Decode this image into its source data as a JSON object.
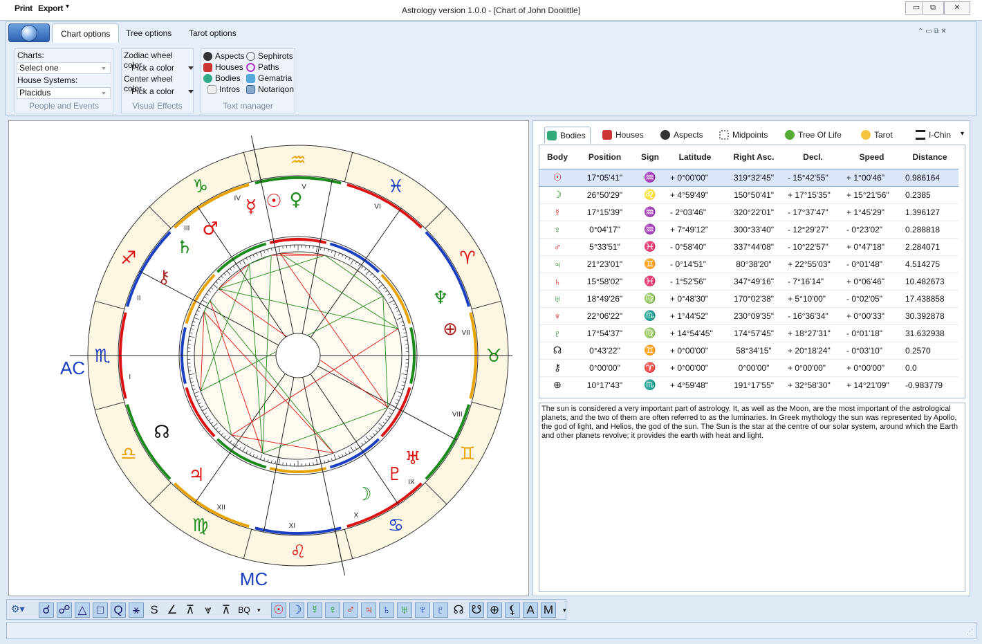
{
  "menu": {
    "print": "Print",
    "export": "Export"
  },
  "window": {
    "title": "Astrology version 1.0.0 - [Chart of John Doolittle]",
    "min": "▭",
    "max": "⧉",
    "close": "✕"
  },
  "ribbon": {
    "tabs": [
      "Chart options",
      "Tree options",
      "Tarot options"
    ],
    "people": {
      "charts_label": "Charts:",
      "charts_value": "Select one",
      "house_label": "House Systems:",
      "house_value": "Placidus",
      "group": "People and Events"
    },
    "visual": {
      "zodiac_label": "Zodiac wheel color",
      "pick1": "Pick a color",
      "center_label": "Center wheel color",
      "pick2": "Pick a color",
      "group": "Visual Effects"
    },
    "text": {
      "aspects": "Aspects",
      "houses": "Houses",
      "bodies": "Bodies",
      "intros": "Intros",
      "sephirots": "Sephirots",
      "paths": "Paths",
      "gematria": "Gematria",
      "notariqon": "Notariqon",
      "group": "Text manager"
    }
  },
  "chart": {
    "signs": [
      "♒",
      "♑",
      "♐",
      "♏",
      "♎",
      "♍",
      "♌",
      "♋",
      "♊",
      "♉",
      "♈",
      "♓"
    ],
    "houses": [
      "I",
      "II",
      "III",
      "IV",
      "V",
      "VI",
      "VII",
      "VIII",
      "IX",
      "X",
      "XI",
      "XII"
    ],
    "ac": "AC",
    "mc": "MC",
    "planets": [
      {
        "g": "♀",
        "c": "#1a8a1a"
      },
      {
        "g": "☉",
        "c": "#d11"
      },
      {
        "g": "☿",
        "c": "#d11"
      },
      {
        "g": "♂",
        "c": "#d11"
      },
      {
        "g": "♄",
        "c": "#1a8a1a"
      },
      {
        "g": "⚷",
        "c": "#a33"
      },
      {
        "g": "♆",
        "c": "#1a8a1a"
      },
      {
        "g": "⊕",
        "c": "#a22"
      },
      {
        "g": "♅",
        "c": "#d11"
      },
      {
        "g": "♇",
        "c": "#d11"
      },
      {
        "g": "☽",
        "c": "#1a8a1a"
      },
      {
        "g": "♃",
        "c": "#d11"
      },
      {
        "g": "☊",
        "c": "#111"
      }
    ]
  },
  "tabs": [
    "Bodies",
    "Houses",
    "Aspects",
    "Midpoints",
    "Tree Of Life",
    "Tarot",
    "I-Chin"
  ],
  "table": {
    "headers": [
      "Body",
      "Position",
      "Sign",
      "Latitude",
      "Right Asc.",
      "Decl.",
      "Speed",
      "Distance"
    ],
    "rows": [
      {
        "b": "☉",
        "bc": "#d11",
        "pos": "17°05'41\"",
        "sign": "♒",
        "signc": "#e8a200",
        "lat": "+  0°00'00\"",
        "ra": "319°32'45\"",
        "dec": "-  15°42'55\"",
        "spd": "+  1°00'46\"",
        "dist": "0.986164"
      },
      {
        "b": "☽",
        "bc": "#1a8a1a",
        "pos": "26°50'29\"",
        "sign": "♌",
        "signc": "#d11",
        "lat": "+  4°59'49\"",
        "ra": "150°50'41\"",
        "dec": "+ 17°15'35\"",
        "spd": "+ 15°21'56\"",
        "dist": "0.2385"
      },
      {
        "b": "☿",
        "bc": "#d11",
        "pos": "17°15'39\"",
        "sign": "♒",
        "signc": "#e8a200",
        "lat": "-  2°03'46\"",
        "ra": "320°22'01\"",
        "dec": "-  17°37'47\"",
        "spd": "+  1°45'29\"",
        "dist": "1.396127"
      },
      {
        "b": "♀",
        "bc": "#1a8a1a",
        "pos": "0°04'17\"",
        "sign": "♒",
        "signc": "#e8a200",
        "lat": "+  7°49'12\"",
        "ra": "300°33'40\"",
        "dec": "-  12°29'27\"",
        "spd": "-  0°23'02\"",
        "dist": "0.288818"
      },
      {
        "b": "♂",
        "bc": "#d11",
        "pos": "5°33'51\"",
        "sign": "♓",
        "signc": "#1a3fc0",
        "lat": "-  0°58'40\"",
        "ra": "337°44'08\"",
        "dec": "-  10°22'57\"",
        "spd": "+  0°47'18\"",
        "dist": "2.284071"
      },
      {
        "b": "♃",
        "bc": "#1a8a1a",
        "pos": "21°23'01\"",
        "sign": "♊",
        "signc": "#e8a200",
        "lat": "-  0°14'51\"",
        "ra": "80°38'20\"",
        "dec": "+ 22°55'03\"",
        "spd": "-  0°01'48\"",
        "dist": "4.514275"
      },
      {
        "b": "♄",
        "bc": "#d11",
        "pos": "15°58'02\"",
        "sign": "♓",
        "signc": "#1a3fc0",
        "lat": "-  1°52'56\"",
        "ra": "347°49'16\"",
        "dec": "-  7°16'14\"",
        "spd": "+  0°06'46\"",
        "dist": "10.482673"
      },
      {
        "b": "♅",
        "bc": "#1a8a1a",
        "pos": "18°49'26\"",
        "sign": "♍",
        "signc": "#1a8a1a",
        "lat": "+  0°48'30\"",
        "ra": "170°02'38\"",
        "dec": "+  5°10'00\"",
        "spd": "-  0°02'05\"",
        "dist": "17.438858"
      },
      {
        "b": "♆",
        "bc": "#d11",
        "pos": "22°06'22\"",
        "sign": "♏",
        "signc": "#1a3fc0",
        "lat": "+  1°44'52\"",
        "ra": "230°09'35\"",
        "dec": "-  16°36'34\"",
        "spd": "+  0°00'33\"",
        "dist": "30.392878"
      },
      {
        "b": "♇",
        "bc": "#1a8a1a",
        "pos": "17°54'37\"",
        "sign": "♍",
        "signc": "#1a8a1a",
        "lat": "+ 14°54'45\"",
        "ra": "174°57'45\"",
        "dec": "+ 18°27'31\"",
        "spd": "-  0°01'18\"",
        "dist": "31.632938"
      },
      {
        "b": "☊",
        "bc": "#111",
        "pos": "0°43'22\"",
        "sign": "♊",
        "signc": "#e8a200",
        "lat": "+  0°00'00\"",
        "ra": "58°34'15\"",
        "dec": "+ 20°18'24\"",
        "spd": "-  0°03'10\"",
        "dist": "0.2570"
      },
      {
        "b": "⚷",
        "bc": "#111",
        "pos": "0°00'00\"",
        "sign": "♈",
        "signc": "#d11",
        "lat": "+  0°00'00\"",
        "ra": "0°00'00\"",
        "dec": "+  0°00'00\"",
        "spd": "+  0°00'00\"",
        "dist": "0.0"
      },
      {
        "b": "⊕",
        "bc": "#111",
        "pos": "10°17'43\"",
        "sign": "♏",
        "signc": "#1a3fc0",
        "lat": "+  4°59'48\"",
        "ra": "191°17'55\"",
        "dec": "+ 32°58'30\"",
        "spd": "+ 14°21'09\"",
        "dist": "-0.983779"
      }
    ]
  },
  "description": "The sun is considered a very important part of astrology. It, as well as the Moon, are the most important of the astrological planets, and the two of them are often referred to as the luminaries. In Greek mythology the sun was represented by Apollo, the god of light, and Helios, the god of the sun. The Sun is the star at the centre of our solar system, around which the Earth and other planets revolve; it provides the earth with heat and light.",
  "toolbar": {
    "aspects": [
      "☌",
      "☍",
      "△",
      "□",
      "Q",
      "⚹",
      "S",
      "∠",
      "⊼",
      "⩔",
      "⊼",
      "BQ"
    ],
    "planets": [
      "☉",
      "☽",
      "☿",
      "♀",
      "♂",
      "♃",
      "♄",
      "♅",
      "♆",
      "♇",
      "☊",
      "☋",
      "⊕",
      "⚸",
      "A",
      "M"
    ]
  }
}
